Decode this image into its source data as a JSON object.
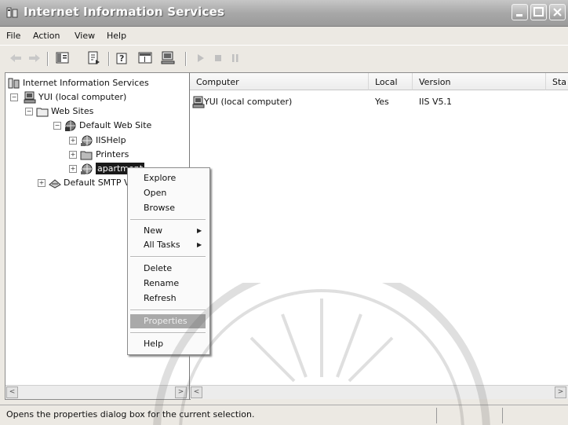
{
  "window": {
    "title": "Internet Information Services",
    "controls": [
      "minimize",
      "maximize",
      "close"
    ]
  },
  "menubar": {
    "items": [
      "File",
      "Action",
      "View",
      "Help"
    ]
  },
  "toolbar": {
    "buttons": [
      "back-icon",
      "forward-icon",
      "show-hide-tree-icon",
      "export-list-icon",
      "help-icon",
      "properties-icon",
      "computer-icon",
      "start-icon",
      "stop-icon",
      "pause-icon"
    ]
  },
  "tree": {
    "root": "Internet Information Services",
    "computer": "YUI (local computer)",
    "web_sites": "Web Sites",
    "default_site": "Default Web Site",
    "iishelp": "IISHelp",
    "printers": "Printers",
    "selected_item": "apartment",
    "smtp": "Default SMTP Virtual Server"
  },
  "list": {
    "columns": [
      "Computer",
      "Local",
      "Version",
      "Sta"
    ],
    "rows": [
      {
        "computer": "YUI (local computer)",
        "local": "Yes",
        "version": "IIS V5.1",
        "status": ""
      }
    ]
  },
  "context_menu": {
    "group1": [
      "Explore",
      "Open",
      "Browse"
    ],
    "new": "New",
    "all_tasks": "All Tasks",
    "group3": [
      "Delete",
      "Rename",
      "Refresh"
    ],
    "properties": "Properties",
    "help": "Help",
    "highlighted": "Properties"
  },
  "statusbar": {
    "text": "Opens the properties dialog box for the current selection."
  },
  "colors": {
    "titlebar": "#a8a8a8",
    "selection": "#1a1a1a",
    "menu_highlight": "#a9a9a9"
  }
}
